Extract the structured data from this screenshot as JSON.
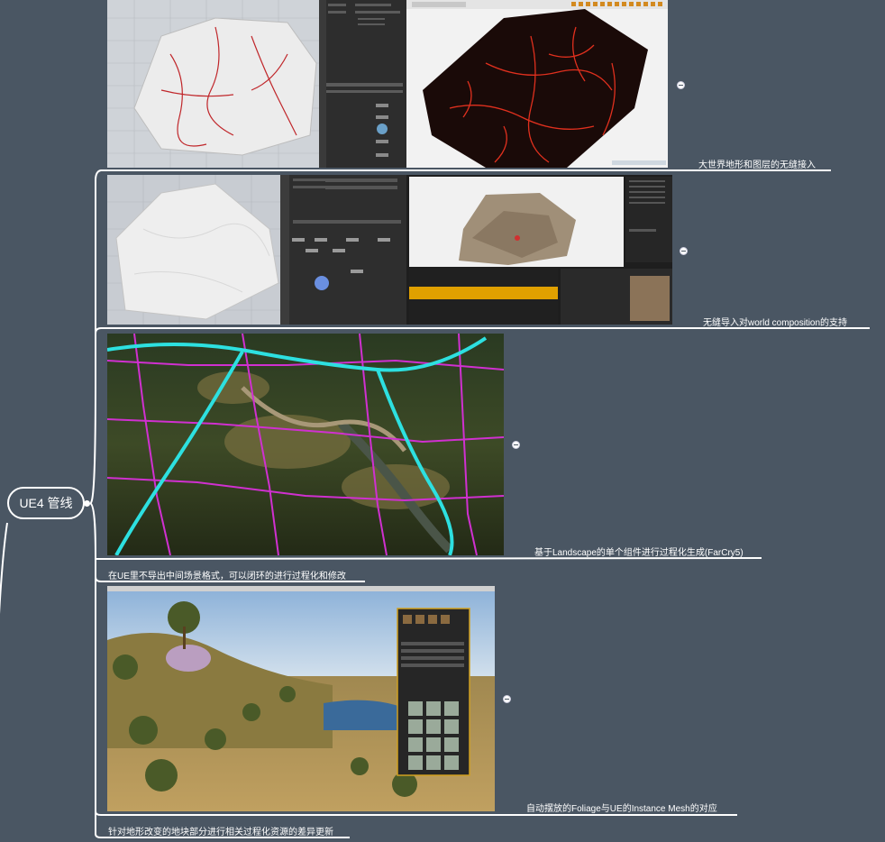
{
  "root": {
    "label": "UE4 管线"
  },
  "branches": [
    {
      "id": "b1",
      "caption": "大世界地形和图层的无缝接入"
    },
    {
      "id": "b2",
      "caption": "无缝导入对world composition的支持"
    },
    {
      "id": "b3",
      "caption": "基于Landscape的单个组件进行过程化生成(FarCry5)"
    },
    {
      "id": "b4",
      "caption": "在UE里不导出中间场景格式，可以闭环的进行过程化和修改"
    },
    {
      "id": "b5",
      "caption": "自动摆放的Foliage与UE的Instance Mesh的对应"
    },
    {
      "id": "b6",
      "caption": "针对地形改变的地块部分进行相关过程化资源的差异更新"
    }
  ],
  "colors": {
    "background": "#4a5663",
    "line": "#ffffff",
    "accent_red": "#e0301e",
    "accent_cyan": "#2de0e0",
    "accent_magenta": "#d030d0",
    "accent_orange": "#e0a000"
  }
}
